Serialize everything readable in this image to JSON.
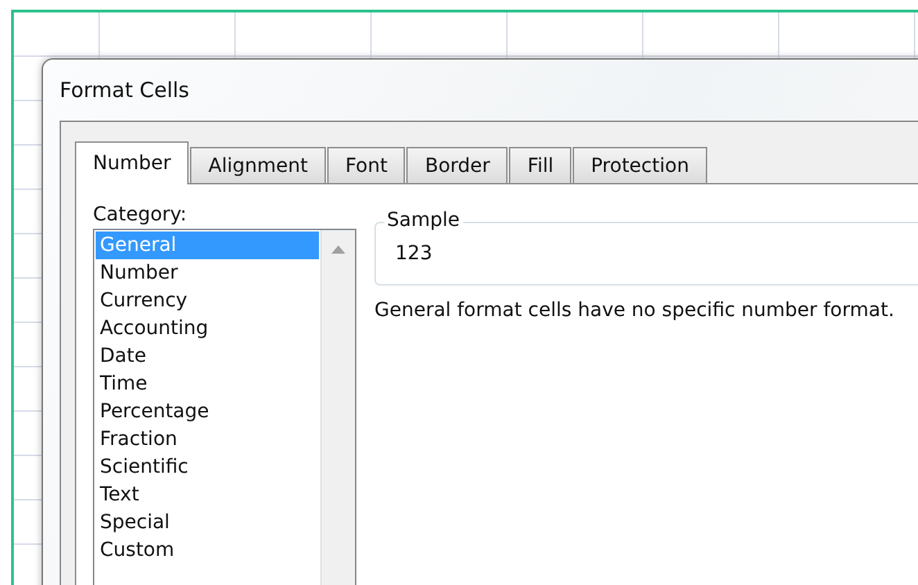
{
  "window": {
    "title": "Format Cells"
  },
  "tabs": [
    {
      "label": "Number",
      "selected": true
    },
    {
      "label": "Alignment",
      "selected": false
    },
    {
      "label": "Font",
      "selected": false
    },
    {
      "label": "Border",
      "selected": false
    },
    {
      "label": "Fill",
      "selected": false
    },
    {
      "label": "Protection",
      "selected": false
    }
  ],
  "category": {
    "label": "Category:",
    "items": [
      {
        "label": "General",
        "selected": true
      },
      {
        "label": "Number",
        "selected": false
      },
      {
        "label": "Currency",
        "selected": false
      },
      {
        "label": "Accounting",
        "selected": false
      },
      {
        "label": "Date",
        "selected": false
      },
      {
        "label": "Time",
        "selected": false
      },
      {
        "label": "Percentage",
        "selected": false
      },
      {
        "label": "Fraction",
        "selected": false
      },
      {
        "label": "Scientific",
        "selected": false
      },
      {
        "label": "Text",
        "selected": false
      },
      {
        "label": "Special",
        "selected": false
      },
      {
        "label": "Custom",
        "selected": false
      }
    ]
  },
  "sample": {
    "label": "Sample",
    "value": "123"
  },
  "description": "General format cells have no specific number format."
}
